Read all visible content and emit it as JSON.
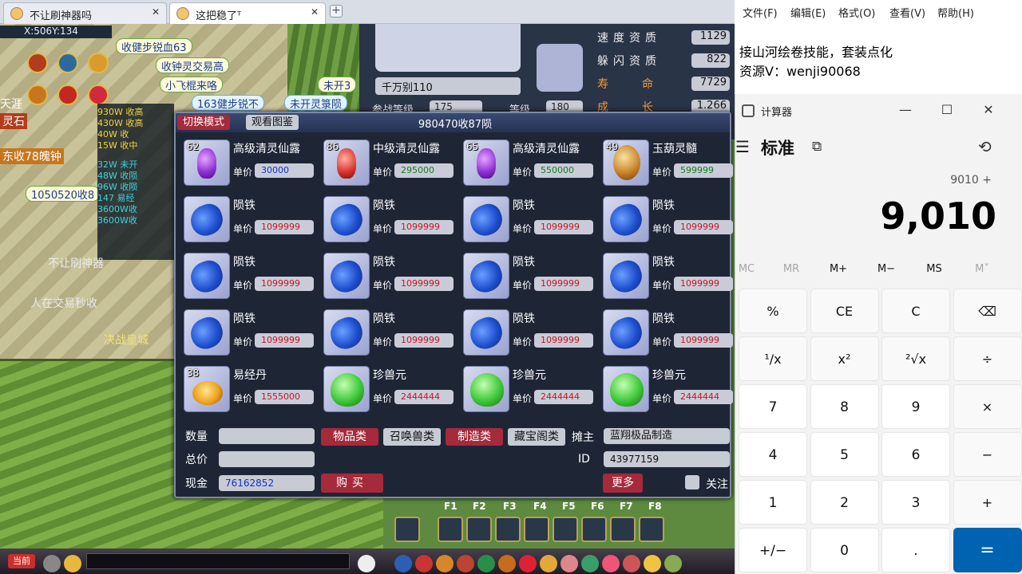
{
  "browser": {
    "tabs": [
      {
        "title": "不让刷神器吗",
        "close": "✕"
      },
      {
        "title": "这把稳了ᵀ",
        "close": "✕"
      }
    ],
    "new_tab": "+"
  },
  "game": {
    "coords": "X:506Y:134",
    "pet": {
      "name": "千万别110",
      "battle_level_label": "参战等级",
      "battle_level": "175",
      "level_label": "等级",
      "level": "180",
      "stats": [
        {
          "label": "速度资质",
          "value": "1129"
        },
        {
          "label": "躲闪资质",
          "value": "822"
        },
        {
          "label": "寿命",
          "value": "7729"
        },
        {
          "label": "成长",
          "value": "1.266"
        }
      ]
    },
    "bubbles": [
      "收健步锐血63",
      "收钟灵交易高",
      "小飞棍来咯",
      "未开3",
      "163健步锐不",
      "未开灵箓陨",
      "1050520收8"
    ],
    "side_lines": [
      "930W 收高",
      "430W 收高",
      "40W 收",
      "15W 收中",
      "32W 未开",
      "48W 收陨",
      "96W 收陨",
      "147 易经",
      "3600W收",
      "3600W收"
    ],
    "overlay_text": [
      "不让刷神器",
      "人在交易秒收",
      "决战皇城",
      "灵石",
      "东收78魄钟",
      "天涯"
    ],
    "fkeys": [
      "F1",
      "F2",
      "F3",
      "F4",
      "F5",
      "F6",
      "F7",
      "F8"
    ],
    "current_channel": "当前"
  },
  "market": {
    "mode_button": "切换模式",
    "view_button": "观看图鉴",
    "stall_title": "980470收87陨",
    "price_label": "单价",
    "items": [
      {
        "name": "高级清灵仙露",
        "qty": "62",
        "price": "30000",
        "price_color": "blue",
        "icon": "potion-icon"
      },
      {
        "name": "中级清灵仙露",
        "qty": "86",
        "price": "295000",
        "price_color": "green",
        "icon": "red-potion-icon"
      },
      {
        "name": "高级清灵仙露",
        "qty": "65",
        "price": "550000",
        "price_color": "green",
        "icon": "potion-icon"
      },
      {
        "name": "玉葫灵髓",
        "qty": "49",
        "price": "599999",
        "price_color": "green",
        "icon": "gourd-icon"
      },
      {
        "name": "陨铁",
        "qty": "",
        "price": "1099999",
        "price_color": "red",
        "icon": "ore-icon"
      },
      {
        "name": "陨铁",
        "qty": "",
        "price": "1099999",
        "price_color": "red",
        "icon": "ore-icon"
      },
      {
        "name": "陨铁",
        "qty": "",
        "price": "1099999",
        "price_color": "red",
        "icon": "ore-icon"
      },
      {
        "name": "陨铁",
        "qty": "",
        "price": "1099999",
        "price_color": "red",
        "icon": "ore-icon"
      },
      {
        "name": "陨铁",
        "qty": "",
        "price": "1099999",
        "price_color": "red",
        "icon": "ore-icon"
      },
      {
        "name": "陨铁",
        "qty": "",
        "price": "1099999",
        "price_color": "red",
        "icon": "ore-icon"
      },
      {
        "name": "陨铁",
        "qty": "",
        "price": "1099999",
        "price_color": "red",
        "icon": "ore-icon"
      },
      {
        "name": "陨铁",
        "qty": "",
        "price": "1099999",
        "price_color": "red",
        "icon": "ore-icon"
      },
      {
        "name": "陨铁",
        "qty": "",
        "price": "1099999",
        "price_color": "red",
        "icon": "ore-icon"
      },
      {
        "name": "陨铁",
        "qty": "",
        "price": "1099999",
        "price_color": "red",
        "icon": "ore-icon"
      },
      {
        "name": "陨铁",
        "qty": "",
        "price": "1099999",
        "price_color": "red",
        "icon": "ore-icon"
      },
      {
        "name": "陨铁",
        "qty": "",
        "price": "1099999",
        "price_color": "red",
        "icon": "ore-icon"
      },
      {
        "name": "易经丹",
        "qty": "38",
        "price": "1555000",
        "price_color": "red",
        "icon": "pill-icon"
      },
      {
        "name": "珍兽元",
        "qty": "",
        "price": "2444444",
        "price_color": "red",
        "icon": "jade-icon"
      },
      {
        "name": "珍兽元",
        "qty": "",
        "price": "2444444",
        "price_color": "red",
        "icon": "jade-icon"
      },
      {
        "name": "珍兽元",
        "qty": "",
        "price": "2444444",
        "price_color": "red",
        "icon": "jade-icon"
      }
    ],
    "quantity_label": "数量",
    "quantity_value": "",
    "total_label": "总价",
    "total_value": "",
    "cash_label": "现金",
    "cash_value": "76162852",
    "categories": [
      "物品类",
      "召唤兽类",
      "制造类",
      "藏宝阁类"
    ],
    "owner_label": "摊主",
    "owner_value": "蓝翔极品制造",
    "id_label": "ID",
    "id_value": "43977159",
    "buy_button": "购买",
    "more_button": "更多",
    "follow_label": "关注"
  },
  "notepad": {
    "menu": [
      "文件(F)",
      "编辑(E)",
      "格式(O)",
      "查看(V)",
      "帮助(H)"
    ],
    "lines": [
      "接山河绘卷技能，套装点化",
      "资源V：wenji90068"
    ]
  },
  "calculator": {
    "title": "计算器",
    "mode": "标准",
    "expression": "9010 +",
    "display": "9,010",
    "memory": [
      "MC",
      "MR",
      "M+",
      "M−",
      "MS",
      "M˅"
    ],
    "keys": [
      "%",
      "CE",
      "C",
      "⌫",
      "¹∕x",
      "x²",
      "²√x",
      "÷",
      "7",
      "8",
      "9",
      "×",
      "4",
      "5",
      "6",
      "−",
      "1",
      "2",
      "3",
      "+",
      "+/−",
      "0",
      ".",
      "="
    ],
    "colors": {
      "accent": "#0063b1"
    }
  }
}
